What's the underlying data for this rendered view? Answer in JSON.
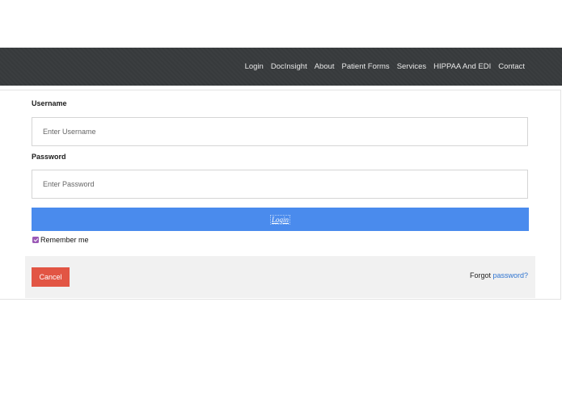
{
  "navbar": {
    "links": [
      {
        "label": "Login"
      },
      {
        "label": "DocInsight"
      },
      {
        "label": "About"
      },
      {
        "label": "Patient Forms"
      },
      {
        "label": "Services"
      },
      {
        "label": "HIPPAA And EDI"
      },
      {
        "label": "Contact"
      }
    ],
    "background": "#373a3c"
  },
  "form": {
    "username_label": "Username",
    "username_placeholder": "Enter Username",
    "username_value": "",
    "password_label": "Password",
    "password_placeholder": "Enter Password",
    "password_value": "",
    "login_button": "Login",
    "login_color": "#4a8bed",
    "remember_label": "Remember me",
    "remember_checked": true
  },
  "footer": {
    "cancel_button": "Cancel",
    "cancel_color": "#e25544",
    "forgot_text": "Forgot ",
    "forgot_link": "password?",
    "link_color": "#2f74d0"
  }
}
